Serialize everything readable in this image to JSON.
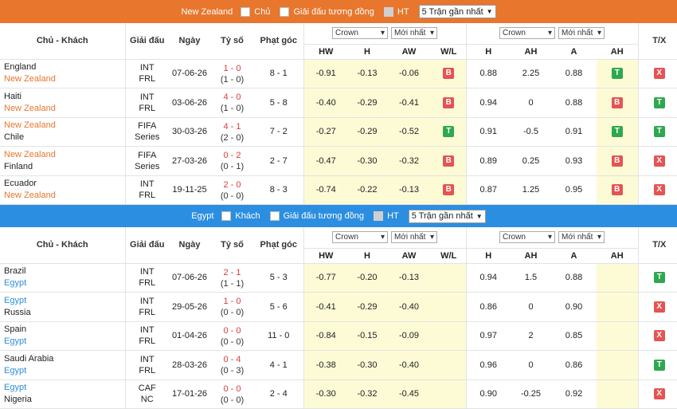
{
  "sections": [
    {
      "team": "New Zealand",
      "filters": {
        "side": "Chủ",
        "same_league": "Giải đấu tương đồng",
        "ht": "HT",
        "range": "5 Trận gần nhất"
      },
      "rows": [
        {
          "home": "England",
          "away": "New Zealand",
          "league": "INT FRL",
          "date": "07-06-26",
          "score": "1 - 0",
          "ht": "(1 - 0)",
          "corners": "8 - 1",
          "hw": "-0.91",
          "h": "-0.13",
          "aw": "-0.06",
          "wl": "B",
          "ah_h": "0.88",
          "ah": "2.25",
          "ah_a": "0.88",
          "ah_res": "T",
          "tx": "X"
        },
        {
          "home": "Haiti",
          "away": "New Zealand",
          "league": "INT FRL",
          "date": "03-06-26",
          "score": "4 - 0",
          "ht": "(1 - 0)",
          "corners": "5 - 8",
          "hw": "-0.40",
          "h": "-0.29",
          "aw": "-0.41",
          "wl": "B",
          "ah_h": "0.94",
          "ah": "0",
          "ah_a": "0.88",
          "ah_res": "B",
          "tx": "T"
        },
        {
          "home": "New Zealand",
          "away": "Chile",
          "league": "FIFA Series",
          "date": "30-03-26",
          "score": "4 - 1",
          "ht": "(2 - 0)",
          "corners": "7 - 2",
          "hw": "-0.27",
          "h": "-0.29",
          "aw": "-0.52",
          "wl": "T",
          "ah_h": "0.91",
          "ah": "-0.5",
          "ah_a": "0.91",
          "ah_res": "T",
          "tx": "T"
        },
        {
          "home": "New Zealand",
          "away": "Finland",
          "league": "FIFA Series",
          "date": "27-03-26",
          "score": "0 - 2",
          "ht": "(0 - 1)",
          "corners": "2 - 7",
          "hw": "-0.47",
          "h": "-0.30",
          "aw": "-0.32",
          "wl": "B",
          "ah_h": "0.89",
          "ah": "0.25",
          "ah_a": "0.93",
          "ah_res": "B",
          "tx": "X"
        },
        {
          "home": "Ecuador",
          "away": "New Zealand",
          "league": "INT FRL",
          "date": "19-11-25",
          "score": "2 - 0",
          "ht": "(0 - 0)",
          "corners": "8 - 3",
          "hw": "-0.74",
          "h": "-0.22",
          "aw": "-0.13",
          "wl": "B",
          "ah_h": "0.87",
          "ah": "1.25",
          "ah_a": "0.95",
          "ah_res": "B",
          "tx": "X"
        }
      ]
    },
    {
      "team": "Egypt",
      "filters": {
        "side": "Khách",
        "same_league": "Giải đấu tương đồng",
        "ht": "HT",
        "range": "5 Trận gần nhất"
      },
      "rows": [
        {
          "home": "Brazil",
          "away": "Egypt",
          "league": "INT FRL",
          "date": "07-06-26",
          "score": "2 - 1",
          "ht": "(1 - 1)",
          "corners": "5 - 3",
          "hw": "-0.77",
          "h": "-0.20",
          "aw": "-0.13",
          "wl": "",
          "ah_h": "0.94",
          "ah": "1.5",
          "ah_a": "0.88",
          "ah_res": "",
          "tx": "T"
        },
        {
          "home": "Egypt",
          "away": "Russia",
          "league": "INT FRL",
          "date": "29-05-26",
          "score": "1 - 0",
          "ht": "(0 - 0)",
          "corners": "5 - 6",
          "hw": "-0.41",
          "h": "-0.29",
          "aw": "-0.40",
          "wl": "",
          "ah_h": "0.86",
          "ah": "0",
          "ah_a": "0.90",
          "ah_res": "",
          "tx": "X"
        },
        {
          "home": "Spain",
          "away": "Egypt",
          "league": "INT FRL",
          "date": "01-04-26",
          "score": "0 - 0",
          "ht": "(0 - 0)",
          "corners": "11 - 0",
          "hw": "-0.84",
          "h": "-0.15",
          "aw": "-0.09",
          "wl": "",
          "ah_h": "0.97",
          "ah": "2",
          "ah_a": "0.85",
          "ah_res": "",
          "tx": "X"
        },
        {
          "home": "Saudi Arabia",
          "away": "Egypt",
          "league": "INT FRL",
          "date": "28-03-26",
          "score": "0 - 4",
          "ht": "(0 - 3)",
          "corners": "4 - 1",
          "hw": "-0.38",
          "h": "-0.30",
          "aw": "-0.40",
          "wl": "",
          "ah_h": "0.96",
          "ah": "0",
          "ah_a": "0.86",
          "ah_res": "",
          "tx": "T"
        },
        {
          "home": "Egypt",
          "away": "Nigeria",
          "league": "CAF NC",
          "date": "17-01-26",
          "score": "0 - 0",
          "ht": "(0 - 0)",
          "corners": "2 - 4",
          "hw": "-0.30",
          "h": "-0.32",
          "aw": "-0.45",
          "wl": "",
          "ah_h": "0.90",
          "ah": "-0.25",
          "ah_a": "0.92",
          "ah_res": "",
          "tx": "X"
        }
      ]
    }
  ],
  "headers": {
    "teams": "Chủ - Khách",
    "league": "Giải đấu",
    "date": "Ngày",
    "score": "Tỷ số",
    "corners": "Phạt góc",
    "bookmaker": "Crown",
    "latest": "Mới nhất",
    "tx": "T/X",
    "hw": "HW",
    "h": "H",
    "aw": "AW",
    "wl": "W/L",
    "ah_h": "H",
    "ah": "AH",
    "ah_a": "A",
    "ah_res": "AH"
  },
  "colors": {
    "nz_bar": "#e8762c",
    "eg_bar": "#2c8ee0",
    "win": "#2ea84f",
    "loss": "#e55353"
  }
}
